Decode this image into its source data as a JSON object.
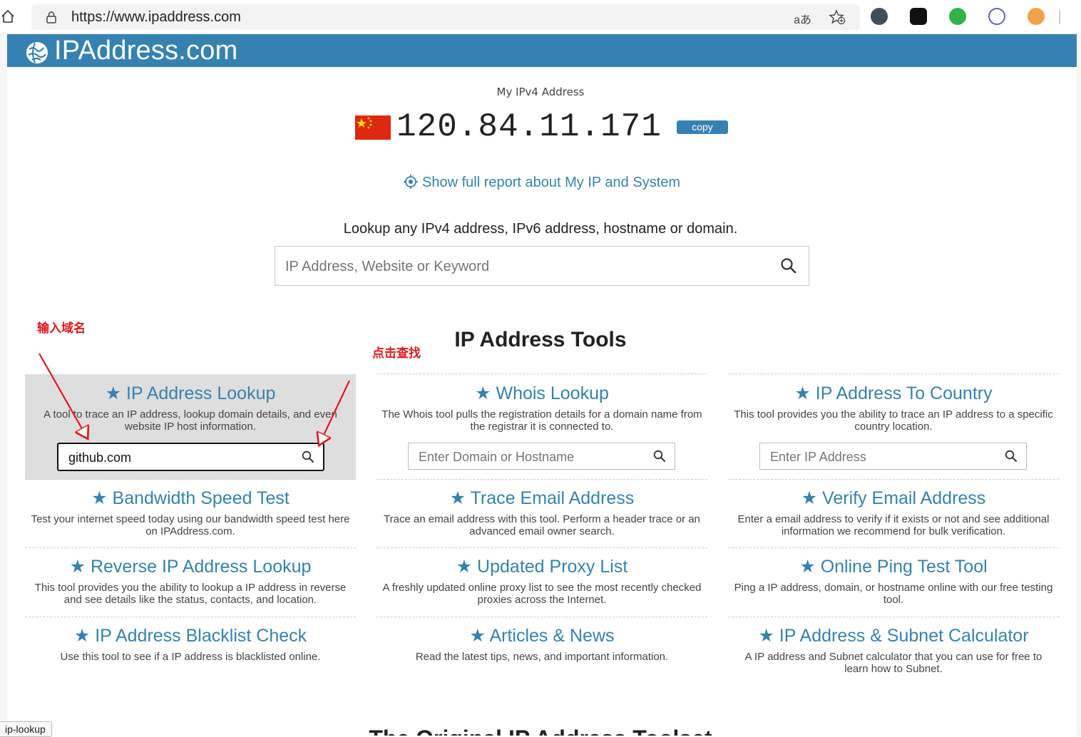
{
  "browser": {
    "url": "https://www.ipaddress.com",
    "translate_glyph": "aあ"
  },
  "site": {
    "brand": "IPAddress.com"
  },
  "hero": {
    "label": "My IPv4 Address",
    "ip": "120.84.11.171",
    "copy_label": "copy",
    "report_link": "Show full report about My IP and System",
    "lookup_prompt": "Lookup any IPv4 address, IPv6 address, hostname or domain.",
    "search_placeholder": "IP Address, Website or Keyword"
  },
  "tools_title": "IP Address Tools",
  "annotations": {
    "enter_domain": "输入域名",
    "click_search": "点击查找"
  },
  "tools": [
    {
      "title": "★ IP Address Lookup",
      "desc": "A tool to trace an IP address, lookup domain details, and even website IP host information.",
      "input_value": "github.com"
    },
    {
      "title": "★ Whois Lookup",
      "desc": "The Whois tool pulls the registration details for a domain name from the registrar it is connected to.",
      "placeholder": "Enter Domain or Hostname"
    },
    {
      "title": "★ IP Address To Country",
      "desc": "This tool provides you the ability to trace an IP address to a specific country location.",
      "placeholder": "Enter IP Address"
    },
    {
      "title": "★ Bandwidth Speed Test",
      "desc": "Test your internet speed today using our bandwidth speed test here on IPAddress.com."
    },
    {
      "title": "★ Trace Email Address",
      "desc": "Trace an email address with this tool. Perform a header trace or an advanced email owner search."
    },
    {
      "title": "★ Verify Email Address",
      "desc": "Enter a email address to verify if it exists or not and see additional information we recommend for bulk verification."
    },
    {
      "title": "★ Reverse IP Address Lookup",
      "desc": "This tool provides you the ability to lookup a IP address in reverse and see details like the status, contacts, and location."
    },
    {
      "title": "★ Updated Proxy List",
      "desc": "A freshly updated online proxy list to see the most recently checked proxies across the Internet."
    },
    {
      "title": "★ Online Ping Test Tool",
      "desc": "Ping a IP address, domain, or hostname online with our free testing tool."
    },
    {
      "title": "★ IP Address Blacklist Check",
      "desc": "Use this tool to see if a IP address is blacklisted online."
    },
    {
      "title": "★ Articles & News",
      "desc": "Read the latest tips, news, and important information."
    },
    {
      "title": "★ IP Address & Subnet Calculator",
      "desc": "A IP address and Subnet calculator that you can use for free to learn how to Subnet."
    }
  ],
  "status_tip": "ip-lookup",
  "next_heading": "The Original IP Address Toolset"
}
